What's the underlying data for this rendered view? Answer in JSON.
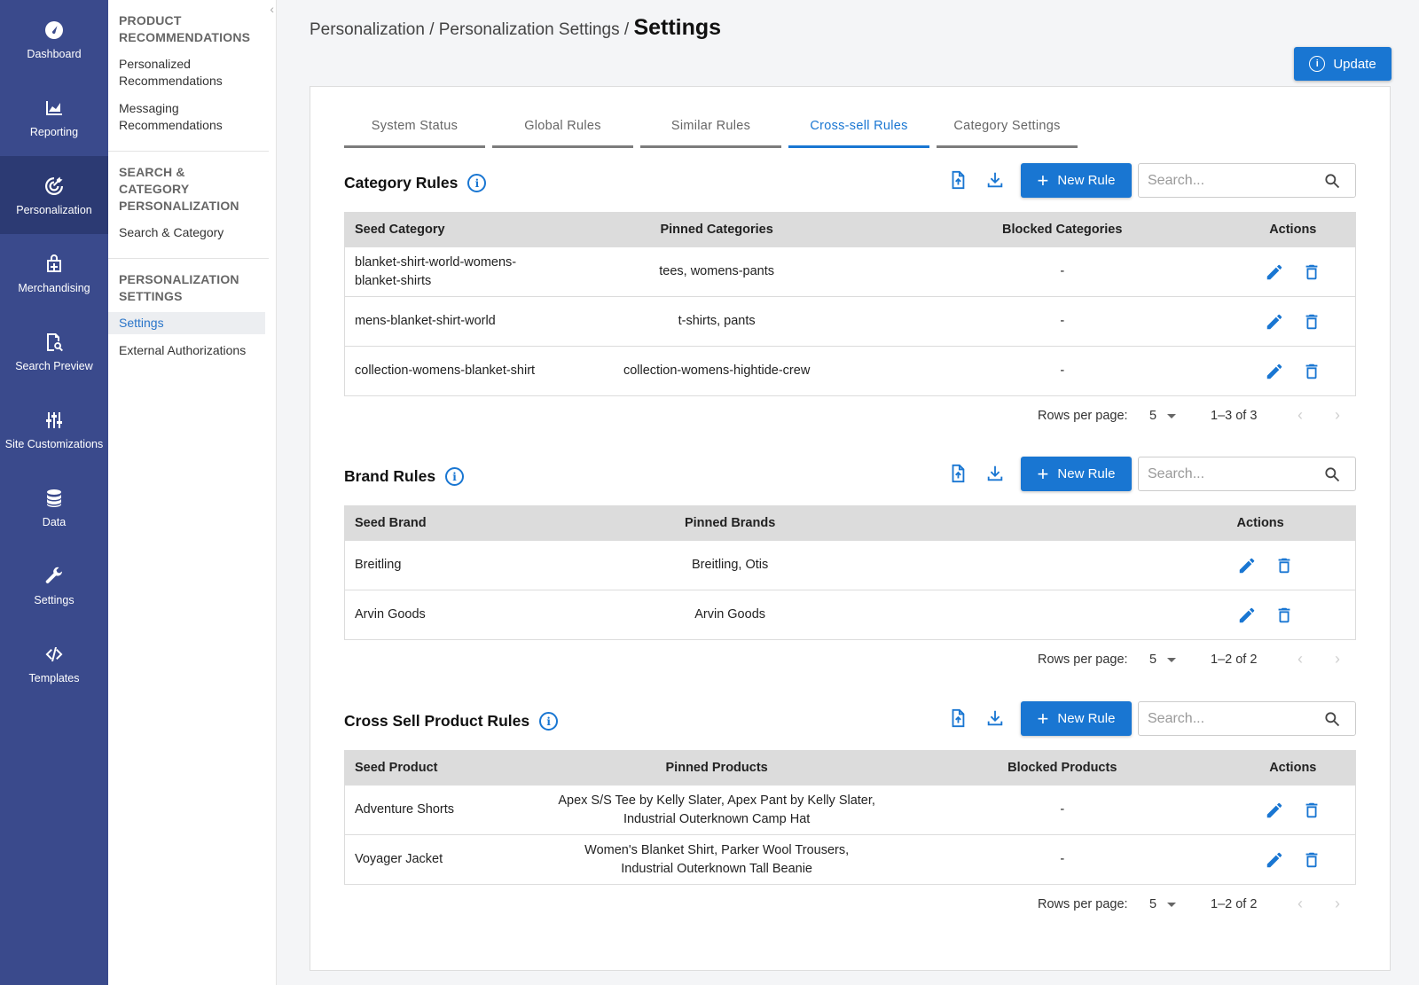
{
  "nav": {
    "items": [
      {
        "label": "Dashboard",
        "icon": "dashboard-icon"
      },
      {
        "label": "Reporting",
        "icon": "chart-icon"
      },
      {
        "label": "Personalization",
        "icon": "target-icon"
      },
      {
        "label": "Merchandising",
        "icon": "bag-icon"
      },
      {
        "label": "Search Preview",
        "icon": "search-preview-icon"
      },
      {
        "label": "Site Customizations",
        "icon": "sliders-icon"
      },
      {
        "label": "Data",
        "icon": "database-icon"
      },
      {
        "label": "Settings",
        "icon": "wrench-icon"
      },
      {
        "label": "Templates",
        "icon": "code-icon"
      }
    ],
    "active_color": "#2c3a73",
    "bg_color": "#3a4a8c"
  },
  "subnav": {
    "sections": [
      {
        "heading": "PRODUCT RECOMMENDATIONS",
        "links": [
          "Personalized Recommendations",
          "Messaging Recommendations"
        ]
      },
      {
        "heading": "SEARCH & CATEGORY PERSONALIZATION",
        "links": [
          "Search & Category"
        ]
      },
      {
        "heading": "PERSONALIZATION SETTINGS",
        "links": [
          "Settings",
          "External Authorizations"
        ]
      }
    ]
  },
  "breadcrumb": {
    "parents": "Personalization / Personalization Settings / ",
    "current": "Settings"
  },
  "update_button": "Update",
  "tabs": [
    "System Status",
    "Global Rules",
    "Similar Rules",
    "Cross-sell Rules",
    "Category Settings"
  ],
  "accent_color": "#1976d2",
  "search_placeholder": "Search...",
  "new_rule_label": "New Rule",
  "rows_per_page_label": "Rows per page:",
  "rows_per_page_value": "5",
  "category_rules": {
    "title": "Category Rules",
    "columns": [
      "Seed Category",
      "Pinned Categories",
      "Blocked Categories",
      "Actions"
    ],
    "rows": [
      [
        "blanket-shirt-world-womens-blanket-shirts",
        "tees, womens-pants",
        "-"
      ],
      [
        "mens-blanket-shirt-world",
        "t-shirts, pants",
        "-"
      ],
      [
        "collection-womens-blanket-shirt",
        "collection-womens-hightide-crew",
        "-"
      ]
    ],
    "range": "1–3 of 3"
  },
  "brand_rules": {
    "title": "Brand Rules",
    "columns": [
      "Seed Brand",
      "Pinned Brands",
      "Actions"
    ],
    "rows": [
      [
        "Breitling",
        "Breitling, Otis"
      ],
      [
        "Arvin Goods",
        "Arvin Goods"
      ]
    ],
    "range": "1–2 of 2"
  },
  "product_rules": {
    "title": "Cross Sell Product Rules",
    "columns": [
      "Seed Product",
      "Pinned Products",
      "Blocked Products",
      "Actions"
    ],
    "rows": [
      [
        "Adventure Shorts",
        "Apex S/S Tee by Kelly Slater, Apex Pant by Kelly Slater, Industrial Outerknown Camp Hat",
        "-"
      ],
      [
        "Voyager Jacket",
        "Women's Blanket Shirt, Parker Wool Trousers, Industrial Outerknown Tall Beanie",
        "-"
      ]
    ],
    "range": "1–2 of 2"
  }
}
